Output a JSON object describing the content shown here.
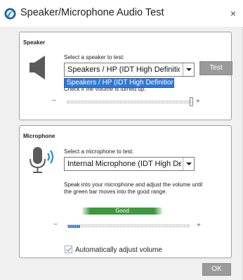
{
  "window": {
    "title": "Speaker/Microphone Audio Test",
    "close_glyph": "×"
  },
  "speaker": {
    "group_title": "Speaker",
    "icon": "speaker-icon",
    "select_label": "Select a speaker to test:",
    "selected_value": "Speakers / HP (IDT High Definition",
    "dropdown_option": "Speakers / HP (IDT High Definition Aud",
    "test_button": "Test",
    "hint": "Check if the volume is turned up.",
    "volume_level": 0.97,
    "minus": "−",
    "plus": "+"
  },
  "microphone": {
    "group_title": "Microphone",
    "icon": "microphone-icon",
    "select_label": "Select a microphone to test:",
    "selected_value": "Internal Microphone (IDT High De",
    "instructions_line1": "Speak into your microphone and adjust the volume until",
    "instructions_line2": "the green bar moves into the good range.",
    "good_label": "Good",
    "input_level": 0.1,
    "minus": "−",
    "plus": "+",
    "auto_adjust_label": "Automatically adjust volume",
    "auto_adjust_checked": true
  },
  "footer": {
    "ok_button": "OK"
  },
  "colors": {
    "accent": "#3078d7",
    "good_green": "#3c9a3c",
    "button_gray": "#9a9a9a"
  }
}
